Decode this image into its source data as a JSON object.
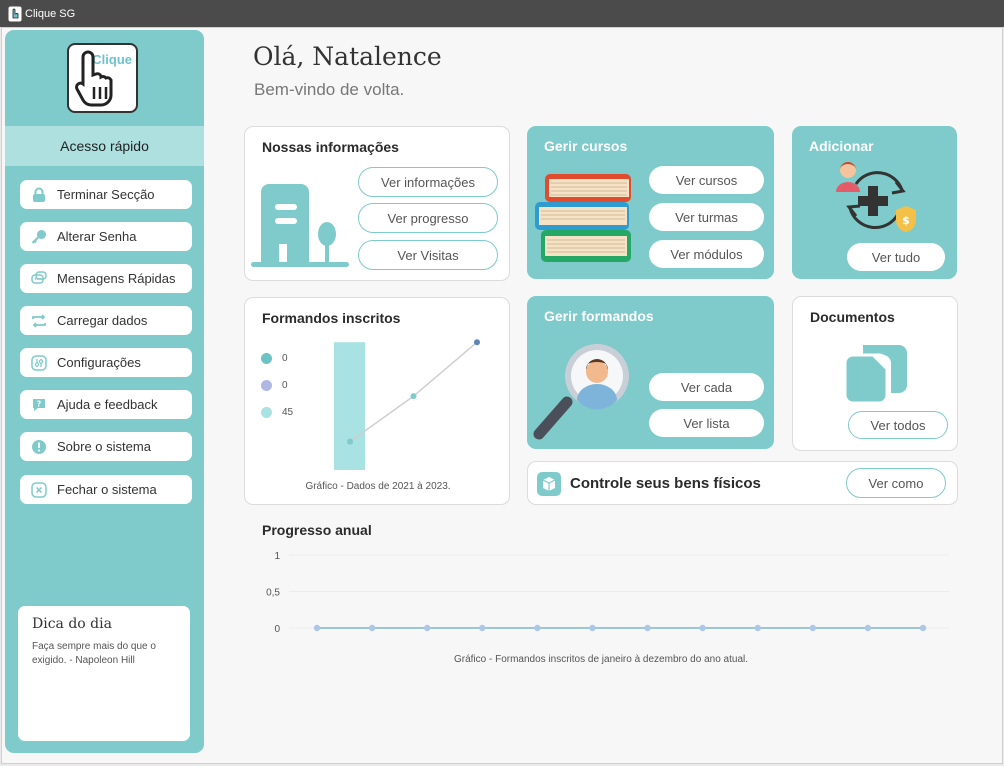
{
  "window": {
    "title": "Clique SG"
  },
  "logo": {
    "text": "Clique"
  },
  "sidebar": {
    "header": "Acesso rápido",
    "items": [
      {
        "label": "Terminar Secção",
        "icon": "lock-icon"
      },
      {
        "label": "Alterar Senha",
        "icon": "key-icon"
      },
      {
        "label": "Mensagens Rápidas",
        "icon": "chat-icon"
      },
      {
        "label": "Carregar dados",
        "icon": "refresh-icon"
      },
      {
        "label": "Configurações",
        "icon": "settings-icon"
      },
      {
        "label": "Ajuda e feedback",
        "icon": "help-icon"
      },
      {
        "label": "Sobre o sistema",
        "icon": "info-icon"
      },
      {
        "label": "Fechar o sistema",
        "icon": "close-icon"
      }
    ],
    "tip": {
      "title": "Dica do dia",
      "text": "Faça sempre mais do que o exigido. - Napoleon Hill"
    }
  },
  "header": {
    "greeting": "Olá, Natalence",
    "welcome": "Bem-vindo de volta."
  },
  "cards": {
    "info": {
      "title": "Nossas informações",
      "buttons": [
        "Ver informações",
        "Ver progresso",
        "Ver Visitas"
      ]
    },
    "courses": {
      "title": "Gerir cursos",
      "buttons": [
        "Ver cursos",
        "Ver turmas",
        "Ver módulos"
      ]
    },
    "add": {
      "title": "Adicionar",
      "button": "Ver tudo"
    },
    "trainees": {
      "title": "Formandos inscritos",
      "caption": "Gráfico - Dados de 2021 à 2023."
    },
    "manage_trainees": {
      "title": "Gerir formandos",
      "buttons": [
        "Ver cada",
        "Ver lista"
      ]
    },
    "documents": {
      "title": "Documentos",
      "button": "Ver todos"
    },
    "assets": {
      "title": "Controle seus bens físicos",
      "button": "Ver como"
    }
  },
  "progress": {
    "title": "Progresso anual",
    "caption": "Gráfico - Formandos inscritos de janeiro à dezembro do ano atual."
  },
  "colors": {
    "accent": "#7fcaca",
    "accent_light": "#aee0e0",
    "line": "#9bc7d2",
    "dot": "#aec6e8"
  },
  "chart_data": [
    {
      "type": "bar",
      "legend": [
        {
          "value": "0",
          "color": "#6cc3c3"
        },
        {
          "value": "0",
          "color": "#aeb8e2"
        },
        {
          "value": "45",
          "color": "#a8e2e2"
        }
      ],
      "bars": [
        45
      ],
      "line": [
        10,
        26,
        45
      ],
      "ylim": [
        0,
        50
      ],
      "caption": "Gráfico - Dados de 2021 à 2023."
    },
    {
      "type": "line",
      "yticks": [
        "1",
        "0,5",
        "0"
      ],
      "ylim": [
        0,
        1
      ],
      "values": [
        0,
        0,
        0,
        0,
        0,
        0,
        0,
        0,
        0,
        0,
        0,
        0
      ],
      "caption": "Gráfico - Formandos inscritos de janeiro à dezembro do ano atual."
    }
  ]
}
